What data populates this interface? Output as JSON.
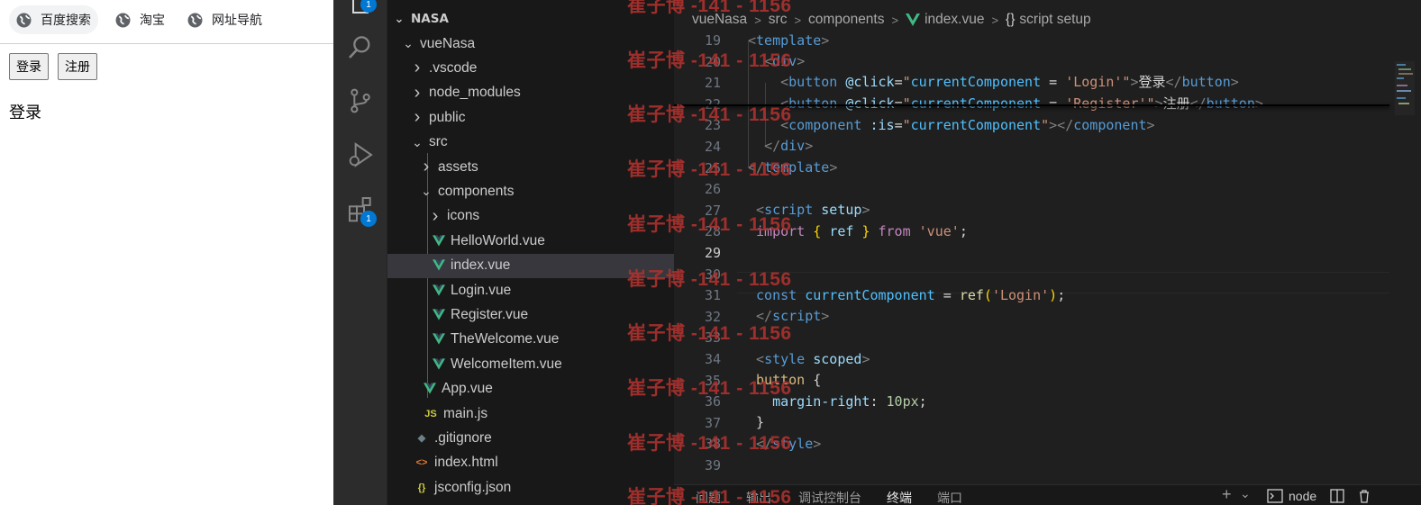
{
  "browser": {
    "bookmarks": [
      {
        "label": "百度搜索",
        "icon": "globe-icon"
      },
      {
        "label": "淘宝",
        "icon": "globe-icon"
      },
      {
        "label": "网址导航",
        "icon": "globe-icon"
      }
    ],
    "buttons": [
      "登录",
      "注册"
    ],
    "component_text": "登录"
  },
  "activity_bar": {
    "icons": [
      "explorer-icon",
      "search-icon",
      "source-control-icon",
      "run-debug-icon",
      "extensions-icon"
    ],
    "explorer_badge": "1",
    "extensions_badge": "1"
  },
  "explorer": {
    "root": "NASA",
    "items": [
      {
        "label": "vueNasa",
        "type": "folder-open"
      },
      {
        "label": ".vscode",
        "type": "folder"
      },
      {
        "label": "node_modules",
        "type": "folder"
      },
      {
        "label": "public",
        "type": "folder"
      },
      {
        "label": "src",
        "type": "folder-open"
      },
      {
        "label": "assets",
        "type": "folder"
      },
      {
        "label": "components",
        "type": "folder-open"
      },
      {
        "label": "icons",
        "type": "folder"
      },
      {
        "label": "HelloWorld.vue",
        "type": "vue"
      },
      {
        "label": "index.vue",
        "type": "vue",
        "selected": true
      },
      {
        "label": "Login.vue",
        "type": "vue"
      },
      {
        "label": "Register.vue",
        "type": "vue"
      },
      {
        "label": "TheWelcome.vue",
        "type": "vue"
      },
      {
        "label": "WelcomeItem.vue",
        "type": "vue"
      },
      {
        "label": "App.vue",
        "type": "vue"
      },
      {
        "label": "main.js",
        "type": "js"
      },
      {
        "label": ".gitignore",
        "type": "git"
      },
      {
        "label": "index.html",
        "type": "html"
      },
      {
        "label": "jsconfig.json",
        "type": "json"
      }
    ],
    "file_icons": {
      "js": "JS",
      "html": "<>",
      "json": "{}",
      "git": "◆"
    }
  },
  "breadcrumb": [
    "vueNasa",
    "src",
    "components",
    "index.vue",
    "script setup"
  ],
  "breadcrumb_symbol": "{}",
  "editor": {
    "line_numbers": [
      "19",
      "20",
      "21",
      "22",
      "23",
      "24",
      "25",
      "26",
      "27",
      "28",
      "29",
      "30",
      "31",
      "32",
      "33",
      "34",
      "35",
      "36",
      "37",
      "38",
      "39"
    ],
    "current_line": "29",
    "code": {
      "l21_text1": "登录",
      "l22_text1": "注册"
    }
  },
  "panel_tabs": [
    "问题",
    "输出",
    "调试控制台",
    "终端",
    "端口"
  ],
  "panel_active": "终端",
  "panel_right": {
    "add": "+",
    "terminal": "node"
  },
  "watermark": "崔子博 -141 - 1156",
  "colors": {
    "accent": "#0078d4",
    "vue_green": "#41b883",
    "js_yellow": "#cbcb41",
    "watermark": "#b0322e"
  }
}
